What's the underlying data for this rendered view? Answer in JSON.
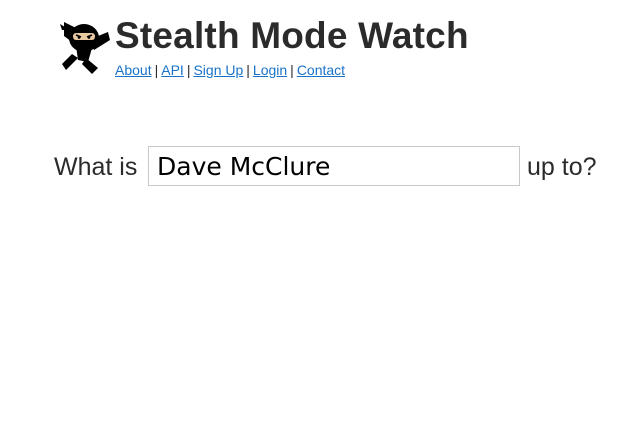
{
  "header": {
    "title": "Stealth Mode Watch",
    "logo_icon": "ninja-logo-icon",
    "nav": [
      {
        "label": "About"
      },
      {
        "label": "API"
      },
      {
        "label": "Sign Up"
      },
      {
        "label": "Login"
      },
      {
        "label": "Contact"
      }
    ],
    "nav_separator": "|"
  },
  "query": {
    "prefix": "What is",
    "value": "Dave McClure",
    "suffix": "up to?"
  },
  "colors": {
    "link": "#1a73c9",
    "text": "#2b2b2b",
    "input_border": "#c9c9c9"
  }
}
